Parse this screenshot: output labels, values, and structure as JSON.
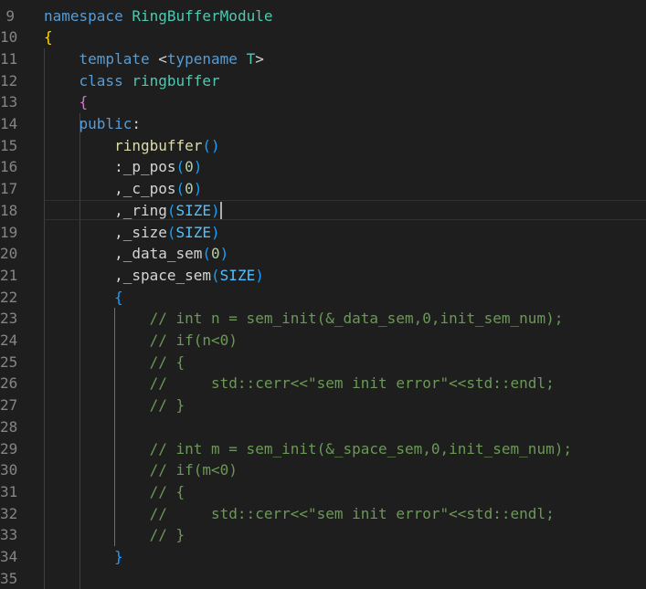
{
  "editor": {
    "language": "cpp",
    "current_line": "18",
    "lines": [
      {
        "no": "9",
        "tokens": [
          {
            "t": "namespace",
            "c": "kw"
          },
          {
            "t": " ",
            "c": "tx"
          },
          {
            "t": "RingBufferModule",
            "c": "tp"
          }
        ]
      },
      {
        "no": "10",
        "tokens": [
          {
            "t": "{",
            "c": "b1"
          }
        ]
      },
      {
        "no": "11",
        "tokens": [
          {
            "t": "    ",
            "c": "tx"
          },
          {
            "t": "template",
            "c": "kw"
          },
          {
            "t": " <",
            "c": "tx"
          },
          {
            "t": "typename",
            "c": "kw"
          },
          {
            "t": " ",
            "c": "tx"
          },
          {
            "t": "T",
            "c": "tparam"
          },
          {
            "t": ">",
            "c": "tx"
          }
        ]
      },
      {
        "no": "12",
        "tokens": [
          {
            "t": "    ",
            "c": "tx"
          },
          {
            "t": "class",
            "c": "kw"
          },
          {
            "t": " ",
            "c": "tx"
          },
          {
            "t": "ringbuffer",
            "c": "tp"
          }
        ]
      },
      {
        "no": "13",
        "tokens": [
          {
            "t": "    ",
            "c": "tx"
          },
          {
            "t": "{",
            "c": "b2"
          }
        ]
      },
      {
        "no": "14",
        "tokens": [
          {
            "t": "    ",
            "c": "tx"
          },
          {
            "t": "public",
            "c": "kw"
          },
          {
            "t": ":",
            "c": "tx"
          }
        ]
      },
      {
        "no": "15",
        "tokens": [
          {
            "t": "        ",
            "c": "tx"
          },
          {
            "t": "ringbuffer",
            "c": "ctor"
          },
          {
            "t": "()",
            "c": "b3"
          }
        ]
      },
      {
        "no": "16",
        "tokens": [
          {
            "t": "        ",
            "c": "tx"
          },
          {
            "t": ":_p_pos",
            "c": "tx"
          },
          {
            "t": "(",
            "c": "b3"
          },
          {
            "t": "0",
            "c": "num"
          },
          {
            "t": ")",
            "c": "b3"
          }
        ]
      },
      {
        "no": "17",
        "tokens": [
          {
            "t": "        ",
            "c": "tx"
          },
          {
            "t": ",_c_pos",
            "c": "tx"
          },
          {
            "t": "(",
            "c": "b3"
          },
          {
            "t": "0",
            "c": "num"
          },
          {
            "t": ")",
            "c": "b3"
          }
        ]
      },
      {
        "no": "18",
        "tokens": [
          {
            "t": "        ",
            "c": "tx"
          },
          {
            "t": ",_ring",
            "c": "tx"
          },
          {
            "t": "(",
            "c": "b3"
          },
          {
            "t": "SIZE",
            "c": "mac"
          },
          {
            "t": ")",
            "c": "b3"
          }
        ]
      },
      {
        "no": "19",
        "tokens": [
          {
            "t": "        ",
            "c": "tx"
          },
          {
            "t": ",_size",
            "c": "tx"
          },
          {
            "t": "(",
            "c": "b3"
          },
          {
            "t": "SIZE",
            "c": "mac"
          },
          {
            "t": ")",
            "c": "b3"
          }
        ]
      },
      {
        "no": "20",
        "tokens": [
          {
            "t": "        ",
            "c": "tx"
          },
          {
            "t": ",_data_sem",
            "c": "tx"
          },
          {
            "t": "(",
            "c": "b3"
          },
          {
            "t": "0",
            "c": "num"
          },
          {
            "t": ")",
            "c": "b3"
          }
        ]
      },
      {
        "no": "21",
        "tokens": [
          {
            "t": "        ",
            "c": "tx"
          },
          {
            "t": ",_space_sem",
            "c": "tx"
          },
          {
            "t": "(",
            "c": "b3"
          },
          {
            "t": "SIZE",
            "c": "mac"
          },
          {
            "t": ")",
            "c": "b3"
          }
        ]
      },
      {
        "no": "22",
        "tokens": [
          {
            "t": "        ",
            "c": "tx"
          },
          {
            "t": "{",
            "c": "b3"
          }
        ]
      },
      {
        "no": "23",
        "tokens": [
          {
            "t": "            ",
            "c": "tx"
          },
          {
            "t": "// int n = sem_init(&_data_sem,0,init_sem_num);",
            "c": "cm"
          }
        ]
      },
      {
        "no": "24",
        "tokens": [
          {
            "t": "            ",
            "c": "tx"
          },
          {
            "t": "// if(n<0)",
            "c": "cm"
          }
        ]
      },
      {
        "no": "25",
        "tokens": [
          {
            "t": "            ",
            "c": "tx"
          },
          {
            "t": "// {",
            "c": "cm"
          }
        ]
      },
      {
        "no": "26",
        "tokens": [
          {
            "t": "            ",
            "c": "tx"
          },
          {
            "t": "//     std::cerr<<\"sem init error\"<<std::endl;",
            "c": "cm"
          }
        ]
      },
      {
        "no": "27",
        "tokens": [
          {
            "t": "            ",
            "c": "tx"
          },
          {
            "t": "// }",
            "c": "cm"
          }
        ]
      },
      {
        "no": "28",
        "tokens": []
      },
      {
        "no": "29",
        "tokens": [
          {
            "t": "            ",
            "c": "tx"
          },
          {
            "t": "// int m = sem_init(&_space_sem,0,init_sem_num);",
            "c": "cm"
          }
        ]
      },
      {
        "no": "30",
        "tokens": [
          {
            "t": "            ",
            "c": "tx"
          },
          {
            "t": "// if(m<0)",
            "c": "cm"
          }
        ]
      },
      {
        "no": "31",
        "tokens": [
          {
            "t": "            ",
            "c": "tx"
          },
          {
            "t": "// {",
            "c": "cm"
          }
        ]
      },
      {
        "no": "32",
        "tokens": [
          {
            "t": "            ",
            "c": "tx"
          },
          {
            "t": "//     std::cerr<<\"sem init error\"<<std::endl;",
            "c": "cm"
          }
        ]
      },
      {
        "no": "33",
        "tokens": [
          {
            "t": "            ",
            "c": "tx"
          },
          {
            "t": "// }",
            "c": "cm"
          }
        ]
      },
      {
        "no": "34",
        "tokens": [
          {
            "t": "        ",
            "c": "tx"
          },
          {
            "t": "}",
            "c": "b3"
          }
        ]
      },
      {
        "no": "35",
        "tokens": []
      }
    ]
  }
}
